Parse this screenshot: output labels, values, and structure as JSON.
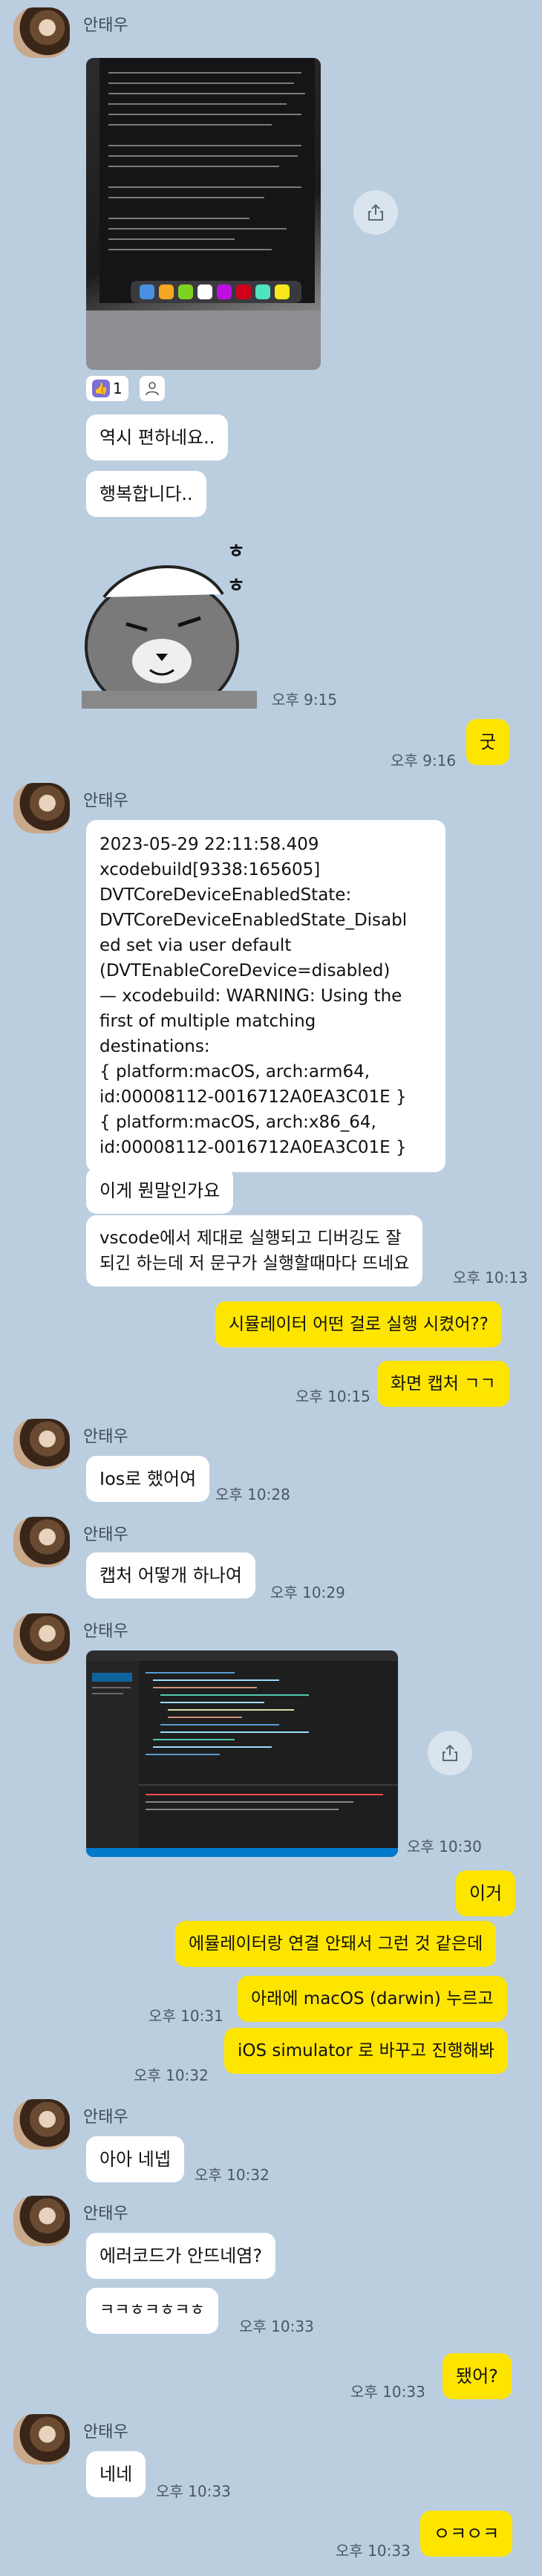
{
  "sender_name": "안태우",
  "reaction": {
    "count": "1"
  },
  "messages": {
    "m1": "역시 편하네요..",
    "m2": "행복합니다..",
    "sticker_text_a": "ㅎ",
    "sticker_text_b": "ㅎ",
    "t1": "오후 9:15",
    "m3": "굿",
    "t2": "오후 9:16",
    "m4": "2023-05-29 22:11:58.409\nxcodebuild[9338:165605]\nDVTCoreDeviceEnabledState:\nDVTCoreDeviceEnabledState_Disabl\ned set via user default\n(DVTEnableCoreDevice=disabled)\n— xcodebuild: WARNING: Using the\nfirst of multiple matching\ndestinations:\n{ platform:macOS, arch:arm64,\nid:00008112-0016712A0EA3C01E }\n{ platform:macOS, arch:x86_64,\nid:00008112-0016712A0EA3C01E }",
    "m5": "이게 뭔말인가요",
    "m6": "vscode에서 제대로 실행되고 디버깅도 잘\n되긴 하는데 저 문구가 실행할때마다 뜨네요",
    "t3": "오후 10:13",
    "m7": "시뮬레이터 어떤 걸로 실행 시켰어??",
    "m8": "화면 캡처 ㄱㄱ",
    "t4": "오후 10:15",
    "m9": "Ios로 했어여",
    "t5": "오후 10:28",
    "m10": "캡처 어떻개 하나여",
    "t6": "오후 10:29",
    "t7": "오후 10:30",
    "m11": "이거",
    "m12": "에뮬레이터랑 연결 안돼서 그런 것 같은데",
    "m13": "아래에 macOS (darwin) 누르고",
    "t8": "오후 10:31",
    "m14": "iOS simulator 로 바꾸고 진행해봐",
    "t9": "오후 10:32",
    "m15": "아아 네넵",
    "t10": "오후 10:32",
    "m16": "에러코드가 안뜨네염?",
    "m17": "ㅋㅋㅎㅋㅎㅋㅎ",
    "t11": "오후 10:33",
    "m18": "됐어?",
    "t12": "오후 10:33",
    "m19": "네네",
    "t13": "오후 10:33",
    "m20": "ㅇㅋㅇㅋ",
    "t14": "오후 10:33"
  }
}
